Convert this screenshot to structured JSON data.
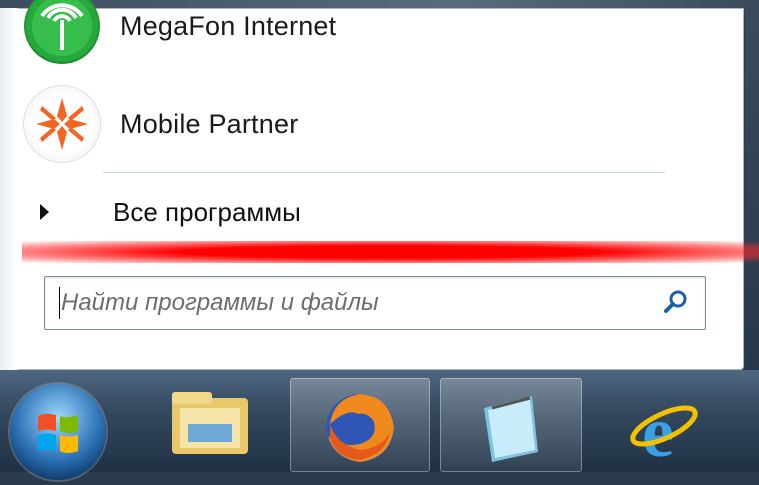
{
  "start_menu": {
    "pinned": [
      {
        "label": "MegaFon Internet",
        "icon": "megafon-internet-icon"
      },
      {
        "label": "Mobile Partner",
        "icon": "mobile-partner-icon"
      }
    ],
    "all_programs_label": "Все программы",
    "search": {
      "placeholder": "Найти программы и файлы",
      "value": ""
    }
  },
  "taskbar": {
    "items": [
      "start-orb",
      "windows-explorer-icon",
      "firefox-icon",
      "notepad-icon",
      "internet-explorer-icon"
    ]
  },
  "colors": {
    "highlight_line": "#ff0000",
    "taskbar": "#2f4358",
    "search_icon": "#1b5fa5"
  }
}
